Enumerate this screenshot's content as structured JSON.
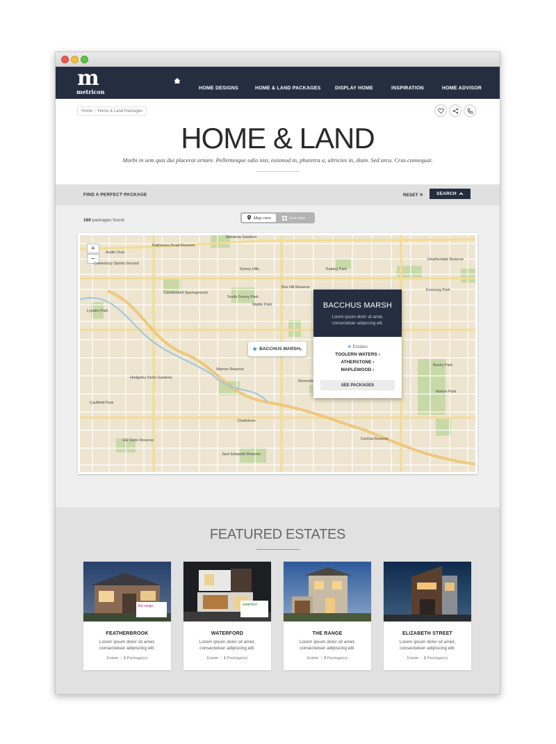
{
  "nav": {
    "logo_mark": "m",
    "logo_text": "metricon",
    "items": [
      "HOME DESIGNS",
      "HOME & LAND PACKAGES",
      "DISPLAY HOME",
      "INSPIRATION",
      "HOME ADVISOR"
    ]
  },
  "breadcrumb": [
    "Home",
    "Home & Land Packages"
  ],
  "page": {
    "title": "HOME & LAND",
    "subtitle": "Morbi in sem quis dui placerat ornare. Pellentesque odio nisi, euismod in, pharetra a, ultricies in, diam. Sed arcu. Cras consequat."
  },
  "filter": {
    "label": "FIND A PERFECT PACKAGE",
    "reset": "RESET",
    "search": "SEARCH"
  },
  "results": {
    "count": "160",
    "count_label": "packages found",
    "map_view": "Map view",
    "list_view": "List view"
  },
  "map": {
    "places": [
      "Audio Ovai",
      "Rathinnes Road Reserve",
      "Maranoa Gardens",
      "Canterbury Sports Ground",
      "Surrey Hills",
      "Kalang Park",
      "Camberwell Sportsground",
      "South Surrey Park",
      "Wattle Park",
      "Box Hill Reserve",
      "Heatherdale Reserve",
      "Lynden Park",
      "Hedgeley Dene Gardens",
      "Caulfield Park",
      "Chadstone",
      "Riversdale Golf Club",
      "Jack Edwards Reserve",
      "EE Gunn Reserve",
      "Koonung Park",
      "Warner Reserve",
      "Central Reserve",
      "Bushy Park",
      "Norton Park"
    ],
    "pin_label": "BACCHUS MARSH",
    "popup": {
      "title": "BACCHUS MARSH",
      "desc": "Lorem ipsum dolor sit amet, consectetuer adipiscing elit.",
      "estates_label": "Estates",
      "estates": [
        "TOOLERN WATERS",
        "ATHERSTONE",
        "MAPLEWOOD"
      ],
      "button": "SEE PACKAGES"
    }
  },
  "featured": {
    "title": "FEATURED ESTATES",
    "cards": [
      {
        "name": "FEATHERBROOK",
        "desc": "Lorem ipsum dolor sit amet, consectetuer adipiscing elit.",
        "type": "Estate",
        "count": "2",
        "packages_label": "Package(s)",
        "badge": "the range"
      },
      {
        "name": "WATERFORD",
        "desc": "Lorem ipsum dolor sit amet, consectetuer adipiscing elit.",
        "type": "Estate",
        "count": "1",
        "packages_label": "Package(s)",
        "badge": "waterford"
      },
      {
        "name": "THE RANGE",
        "desc": "Lorem ipsum dolor sit amet, consectetuer adipiscing elit.",
        "type": "Estate",
        "count": "3",
        "packages_label": "Package(s)",
        "badge": ""
      },
      {
        "name": "ELIZABETH STREET",
        "desc": "Lorem ipsum dolor sit amet, consectetuer adipiscing elit.",
        "type": "Estate",
        "count": "2",
        "packages_label": "Package(s)",
        "badge": ""
      }
    ]
  },
  "colors": {
    "navy": "#252d40",
    "star": "#3a8fd9",
    "map_bg": "#ede5d0",
    "park": "#c8d9a7"
  }
}
